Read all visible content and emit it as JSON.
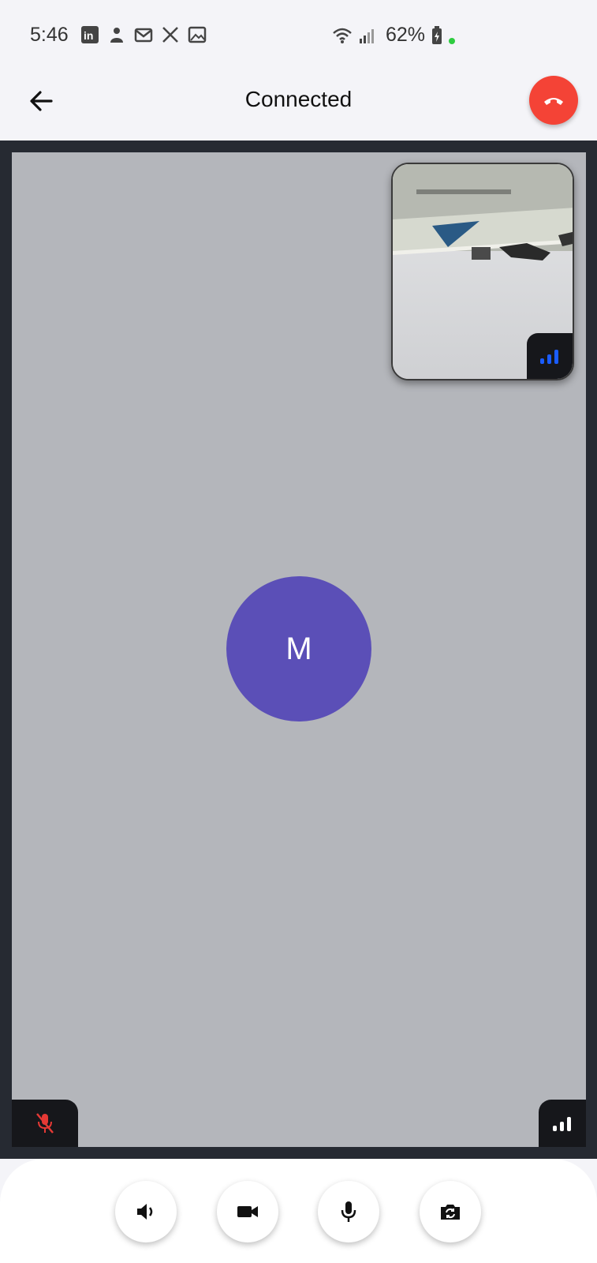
{
  "status_bar": {
    "time": "5:46",
    "notification_icons": [
      "linkedin-icon",
      "app-icon",
      "mail-icon",
      "x-icon",
      "gallery-icon"
    ],
    "battery_percent": "62%",
    "wifi": "wifi-icon",
    "signal": "signal-icon"
  },
  "header": {
    "title": "Connected",
    "back_icon": "arrow-left-icon",
    "end_call_icon": "phone-hangup-icon",
    "end_call_color": "#f44336"
  },
  "remote": {
    "avatar_initial": "M",
    "avatar_color": "#5b4fb7",
    "mic_state": "muted",
    "mic_icon": "mic-off-icon",
    "network_icon": "signal-bars-icon"
  },
  "local_preview": {
    "network_icon": "signal-bars-icon",
    "network_color": "#1a5cff"
  },
  "controls": [
    {
      "name": "speaker",
      "icon": "speaker-icon"
    },
    {
      "name": "camera",
      "icon": "video-camera-icon"
    },
    {
      "name": "microphone",
      "icon": "microphone-icon"
    },
    {
      "name": "switch-camera",
      "icon": "camera-switch-icon"
    }
  ]
}
